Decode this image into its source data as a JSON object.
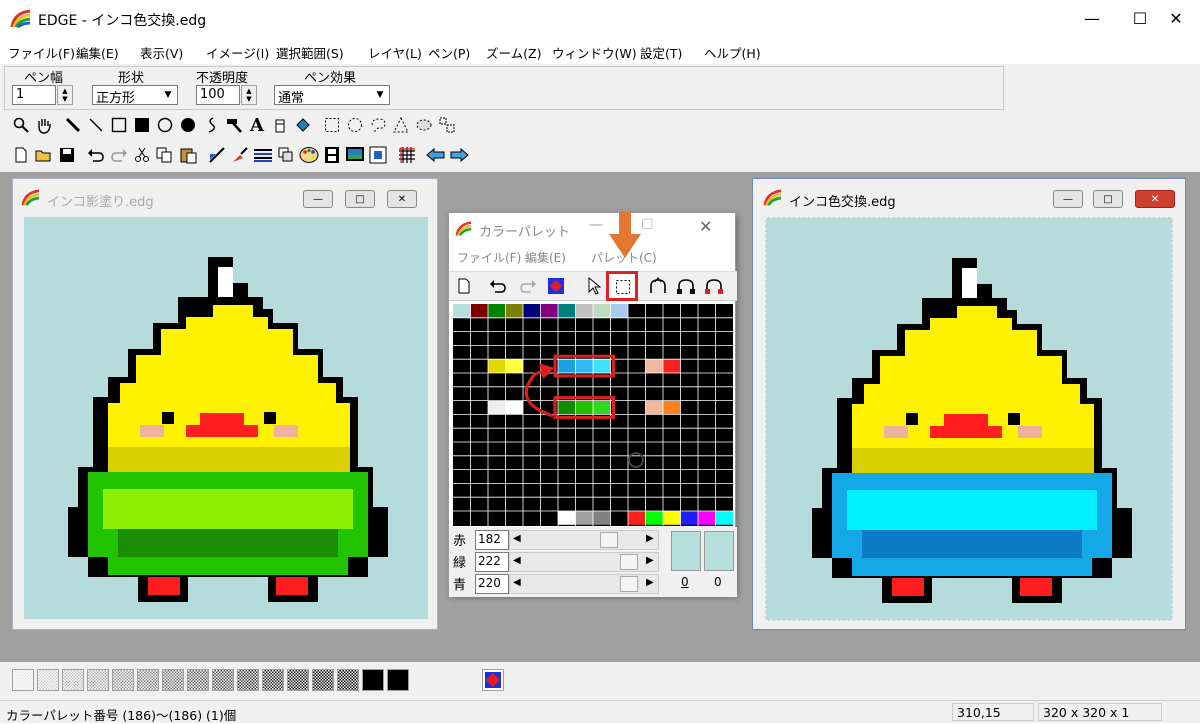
{
  "window": {
    "title": "EDGE - インコ色交換.edg",
    "min": "—",
    "max": "☐",
    "close": "✕"
  },
  "menu": [
    "ファイル(F)",
    "編集(E)",
    "表示(V)",
    "イメージ(I)",
    "選択範囲(S)",
    "レイヤ(L)",
    "ペン(P)",
    "ズーム(Z)",
    "ウィンドウ(W)",
    "設定(T)",
    "ヘルプ(H)"
  ],
  "pen_bar": {
    "width_label": "ペン幅",
    "width_value": "1",
    "shape_label": "形状",
    "shape_value": "正方形",
    "opacity_label": "不透明度",
    "opacity_value": "100",
    "effect_label": "ペン効果",
    "effect_value": "通常"
  },
  "toolbar1": [
    "zoom-tool",
    "hand-tool",
    "pencil-tool",
    "line-tool",
    "rect-tool",
    "filled-rect-tool",
    "ellipse-tool",
    "filled-ellipse-tool",
    "curve-tool",
    "hammer-tool",
    "text-tool",
    "eraser-tool",
    "fill-tool",
    "rect-select-tool",
    "ellipse-select-tool",
    "lasso-select-tool",
    "polygon-select-tool",
    "color-select-tool",
    "transform-tool"
  ],
  "toolbar2": [
    "new-file",
    "open-file",
    "save-file",
    "undo",
    "redo",
    "cut",
    "copy",
    "paste",
    "flip-tool",
    "brush-tool",
    "grid-lines",
    "layers",
    "palette",
    "film",
    "preview",
    "image-size",
    "grid-toggle",
    "arrow-left",
    "arrow-right"
  ],
  "doc_left": {
    "title": "インコ影塗り.edg",
    "min": "—",
    "max": "□",
    "close": "✕"
  },
  "doc_right": {
    "title": "インコ色交換.edg",
    "min": "—",
    "max": "□",
    "close": "✕"
  },
  "palette_window": {
    "title": "カラーパレット",
    "menu": [
      "ファイル(F)",
      "編集(E)",
      "パレット(C)"
    ],
    "rgb": [
      {
        "label": "赤",
        "value": "182"
      },
      {
        "label": "緑",
        "value": "222"
      },
      {
        "label": "青",
        "value": "220"
      }
    ],
    "index_a": "0",
    "index_b": "0",
    "selected_color": "#b6dedc",
    "swatch_colors": [
      "#b6dedc",
      "#800000",
      "#008000",
      "#808000",
      "#000080",
      "#800080",
      "#008080",
      "#c0c0c0",
      "#c0dcc0",
      "#a6caf0"
    ]
  },
  "colors": {
    "canvas_bg": "#b5dbdc",
    "workspace": "#a0a0a0",
    "highlight": "#e02020",
    "arrow": "#e07830"
  },
  "status": {
    "message": "カラーパレット番号 (186)〜(186) (1)個",
    "coords": "310,15",
    "size": "320 x 320 x 1"
  }
}
